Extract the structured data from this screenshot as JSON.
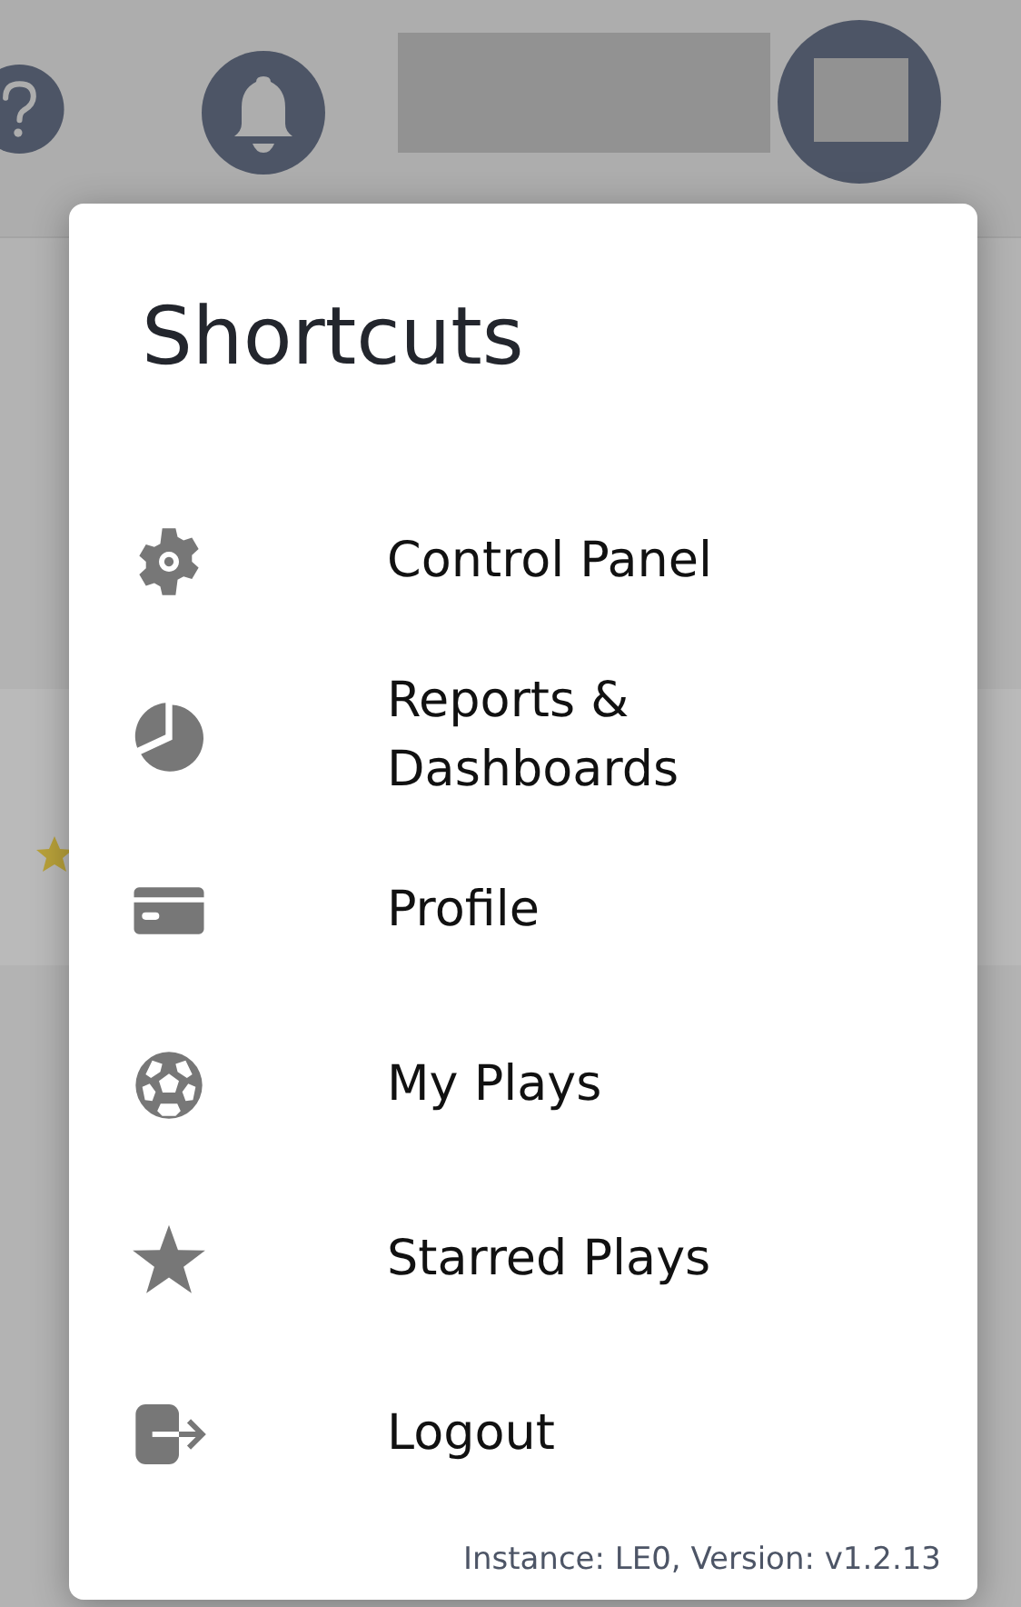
{
  "shortcuts": {
    "title": "Shortcuts",
    "items": [
      {
        "label": "Control Panel"
      },
      {
        "label": "Reports & Dashboards"
      },
      {
        "label": "Profile"
      },
      {
        "label": "My Plays"
      },
      {
        "label": "Starred Plays"
      },
      {
        "label": "Logout"
      }
    ],
    "footer": "Instance: LE0, Version: v1.2.13"
  }
}
